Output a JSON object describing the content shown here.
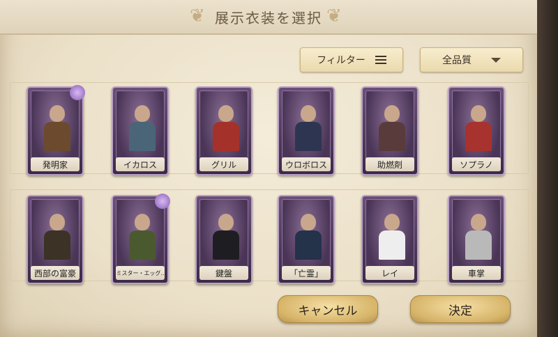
{
  "header": {
    "title": "展示衣装を選択"
  },
  "toolbar": {
    "filter_label": "フィルター",
    "quality_label": "全品質"
  },
  "cards": [
    {
      "name": "発明家",
      "outfit": "#6b4a2e",
      "row": 0
    },
    {
      "name": "イカロス",
      "outfit": "#4a6478",
      "row": 0
    },
    {
      "name": "グリル",
      "outfit": "#a4322a",
      "row": 0
    },
    {
      "name": "ウロボロス",
      "outfit": "#2e3550",
      "row": 0
    },
    {
      "name": "助燃剤",
      "outfit": "#5a3b3b",
      "row": 0
    },
    {
      "name": "ソプラノ",
      "outfit": "#a8322d",
      "row": 0
    },
    {
      "name": "西部の富豪",
      "outfit": "#3c3226",
      "row": 1
    },
    {
      "name": "ミスター・エッグ..",
      "outfit": "#4a5a2e",
      "row": 1
    },
    {
      "name": "鍵盤",
      "outfit": "#1e1e22",
      "row": 1
    },
    {
      "name": "「亡霊」",
      "outfit": "#24324a",
      "row": 1
    },
    {
      "name": "レイ",
      "outfit": "#eeeeee",
      "row": 1
    },
    {
      "name": "車掌",
      "outfit": "#b9b9b9",
      "row": 1
    }
  ],
  "footer": {
    "cancel_label": "キャンセル",
    "ok_label": "決定"
  },
  "colors": {
    "card_frame": "#b9a2c4",
    "panel_bg": "#ebe0c8",
    "button_gold": "#d7b56a"
  }
}
